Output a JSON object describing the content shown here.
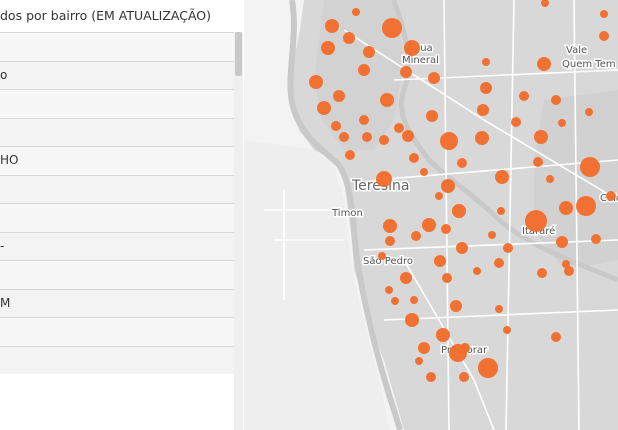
{
  "panel": {
    "title": "dos por bairro (EM ATUALIZAÇÃO)",
    "rows": [
      "",
      "o",
      "",
      "",
      "HO",
      "",
      "",
      "-",
      "",
      "M",
      "",
      ""
    ]
  },
  "map": {
    "labels": {
      "agua_mineral_1": "Água",
      "agua_mineral_2": "Mineral",
      "vale_1": "Vale",
      "vale_2": "Quem Tem",
      "teresina": "Teresina",
      "timon": "Timon",
      "itarare": "Itararé",
      "colorado": "Colora",
      "sao_pedro": "São Pedro",
      "promorar": "Promorar"
    },
    "marker_color": "#f26c2a"
  }
}
